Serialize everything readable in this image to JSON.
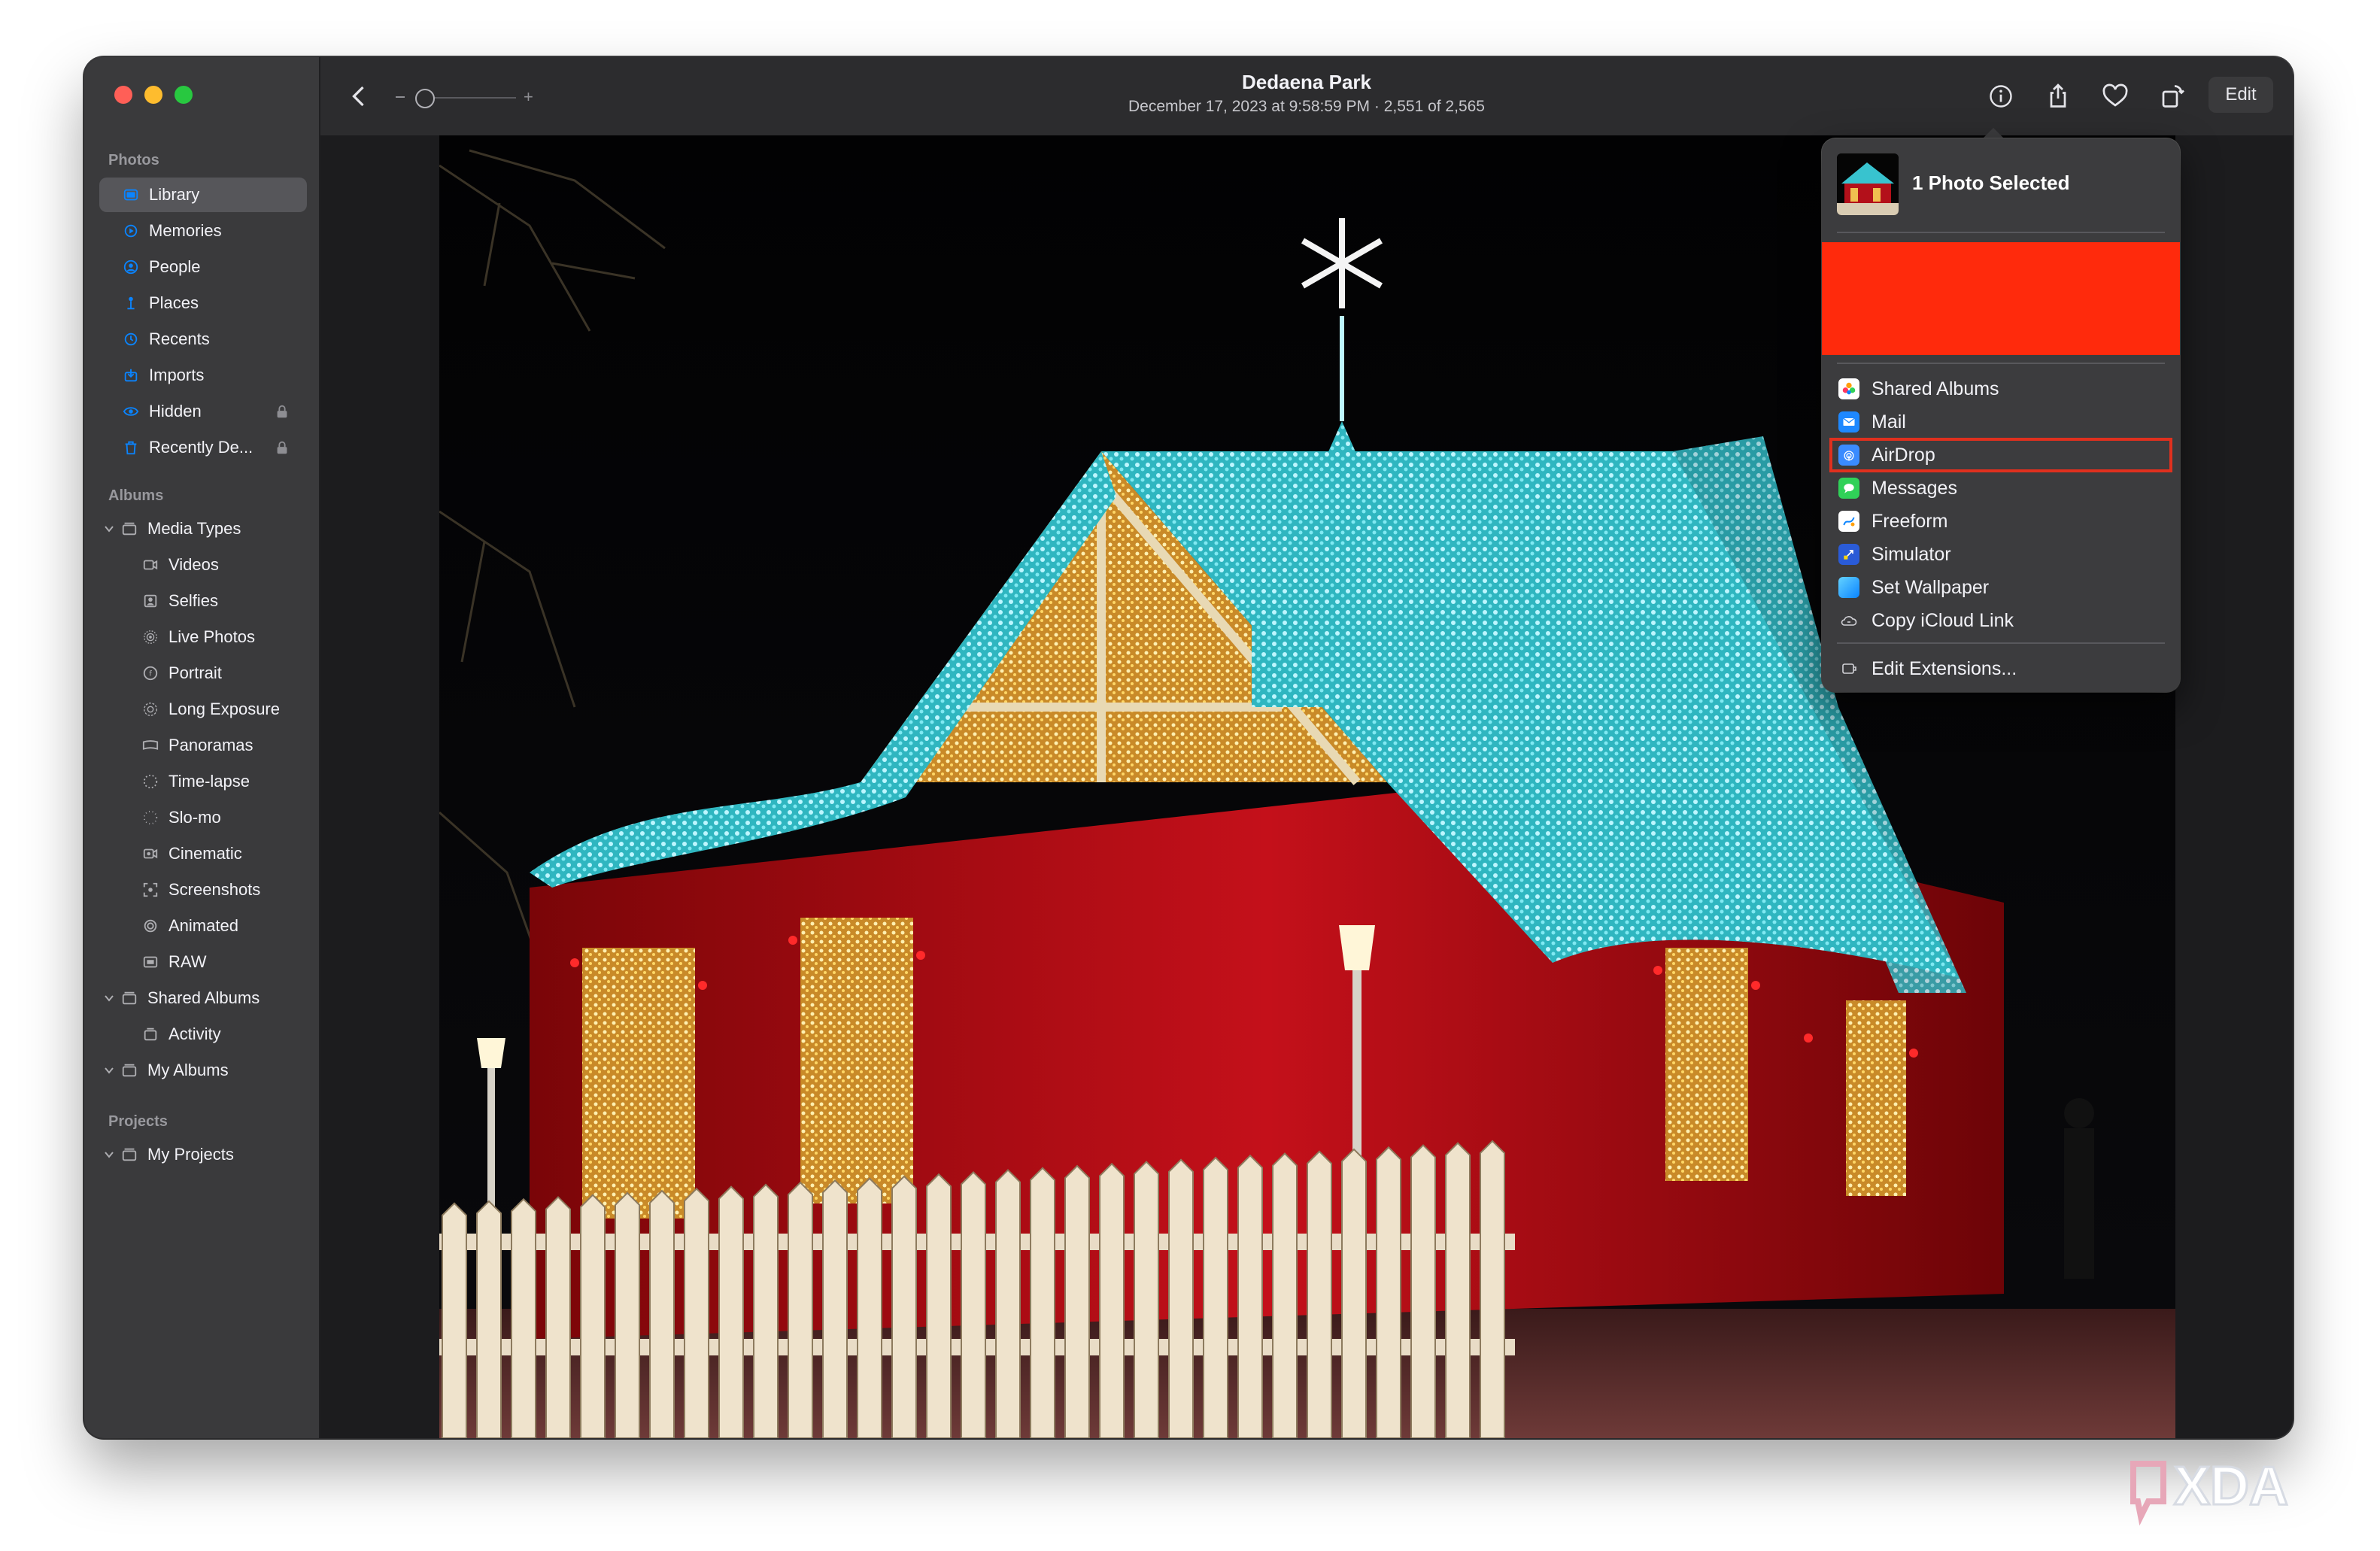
{
  "window": {
    "title": "Dedaena Park",
    "subtitle": "December 17, 2023 at 9:58:59 PM  ·  2,551 of 2,565",
    "edit_label": "Edit"
  },
  "sidebar": {
    "photos_section": "Photos",
    "photos_items": [
      {
        "label": "Library",
        "icon": "library-icon",
        "selected": true
      },
      {
        "label": "Memories",
        "icon": "memories-icon"
      },
      {
        "label": "People",
        "icon": "people-icon"
      },
      {
        "label": "Places",
        "icon": "places-icon"
      },
      {
        "label": "Recents",
        "icon": "recents-icon"
      },
      {
        "label": "Imports",
        "icon": "imports-icon"
      },
      {
        "label": "Hidden",
        "icon": "hidden-icon",
        "locked": true
      },
      {
        "label": "Recently De...",
        "icon": "trash-icon",
        "locked": true
      }
    ],
    "albums_section": "Albums",
    "media_types_label": "Media Types",
    "media_types": [
      {
        "label": "Videos",
        "icon": "videos-icon"
      },
      {
        "label": "Selfies",
        "icon": "selfies-icon"
      },
      {
        "label": "Live Photos",
        "icon": "live-photos-icon"
      },
      {
        "label": "Portrait",
        "icon": "portrait-icon"
      },
      {
        "label": "Long Exposure",
        "icon": "long-exposure-icon"
      },
      {
        "label": "Panoramas",
        "icon": "panoramas-icon"
      },
      {
        "label": "Time-lapse",
        "icon": "time-lapse-icon"
      },
      {
        "label": "Slo-mo",
        "icon": "slo-mo-icon"
      },
      {
        "label": "Cinematic",
        "icon": "cinematic-icon"
      },
      {
        "label": "Screenshots",
        "icon": "screenshots-icon"
      },
      {
        "label": "Animated",
        "icon": "animated-icon"
      },
      {
        "label": "RAW",
        "icon": "raw-icon"
      }
    ],
    "shared_albums_label": "Shared Albums",
    "activity_label": "Activity",
    "my_albums_label": "My Albums",
    "projects_section": "Projects",
    "my_projects_label": "My Projects"
  },
  "share_menu": {
    "header": "1 Photo Selected",
    "items": [
      {
        "label": "Shared Albums",
        "icon": "shared-albums-icon"
      },
      {
        "label": "Mail",
        "icon": "mail-icon"
      },
      {
        "label": "AirDrop",
        "icon": "airdrop-icon",
        "highlighted": true
      },
      {
        "label": "Messages",
        "icon": "messages-icon"
      },
      {
        "label": "Freeform",
        "icon": "freeform-icon"
      },
      {
        "label": "Simulator",
        "icon": "simulator-icon"
      },
      {
        "label": "Set Wallpaper",
        "icon": "wallpaper-icon"
      },
      {
        "label": "Copy iCloud Link",
        "icon": "icloud-icon"
      }
    ],
    "edit_extensions": "Edit Extensions..."
  },
  "watermark": "XDA",
  "colors": {
    "accent": "#0a84ff",
    "redaction": "#ff2a0c",
    "highlight_outline": "#e0301e",
    "window_bg": "#1c1c1e",
    "sidebar_bg": "#3a3a3c",
    "toolbar_bg": "#2c2c2e"
  }
}
